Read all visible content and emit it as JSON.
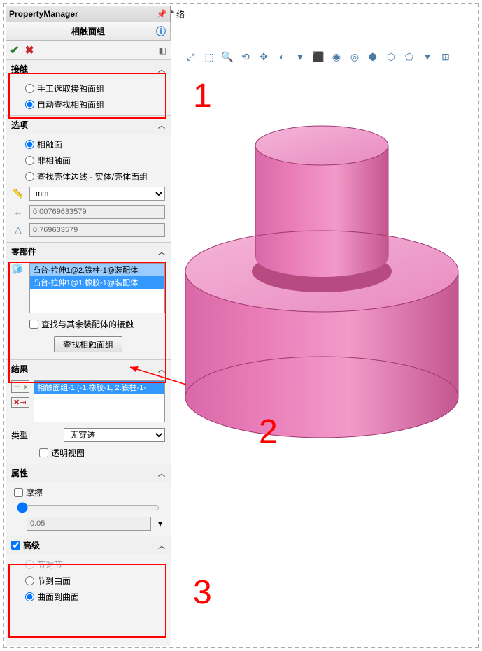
{
  "header": {
    "title": "PropertyManager",
    "subtitle": "相触面组"
  },
  "sections": {
    "contact": {
      "title": "接触",
      "opt_manual": "手工选取接触面组",
      "opt_auto": "自动查找相触面组"
    },
    "options": {
      "title": "选项",
      "opt_contact": "相触面",
      "opt_noncontact": "非相触面",
      "opt_shell": "查找壳体边线 - 实体/壳体面组",
      "unit": "mm",
      "val1": "0.00769633579",
      "val2": "0.769633579"
    },
    "components": {
      "title": "零部件",
      "item1": "凸台-拉伸1@2.铁柱-1@装配体.",
      "item2": "凸台-拉伸1@1.橡胶-1@装配体.",
      "chk_label": "查找与其余装配体的接触",
      "btn_label": "查找相触面组"
    },
    "results": {
      "title": "结果",
      "item1": "相触面组-1 (-1.橡胶-1, 2.铁柱-1-",
      "type_label": "类型:",
      "type_value": "无穿透",
      "transparent": "透明视图"
    },
    "properties": {
      "title": "属性",
      "friction": "摩擦",
      "friction_val": "0.05"
    },
    "advanced": {
      "title": "高级",
      "opt1": "节对节",
      "opt2": "节到曲面",
      "opt3": "曲面到曲面"
    }
  },
  "annotations": {
    "n1": "1",
    "n2": "2",
    "n3": "3"
  },
  "right_label": "络"
}
